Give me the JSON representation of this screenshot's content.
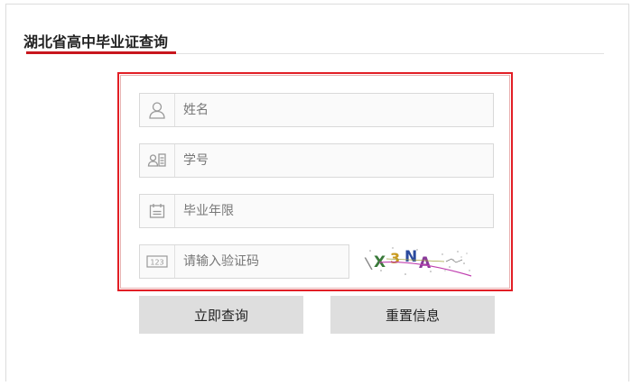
{
  "header": {
    "title": "湖北省高中毕业证查询"
  },
  "form": {
    "name_placeholder": "姓名",
    "student_id_placeholder": "学号",
    "grad_year_placeholder": "毕业年限",
    "captcha_placeholder": "请输入验证码",
    "captcha_text": "X3NA"
  },
  "buttons": {
    "query_label": "立即查询",
    "reset_label": "重置信息"
  },
  "colors": {
    "accent": "#c8161d",
    "form_border": "#e21e25",
    "button_bg": "#dedede"
  }
}
